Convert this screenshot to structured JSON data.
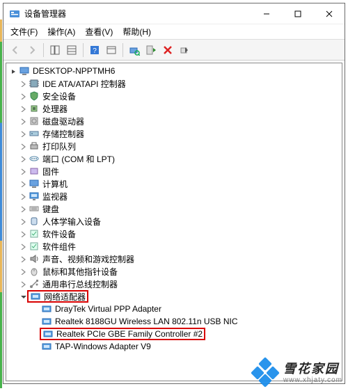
{
  "title": "设备管理器",
  "menu": {
    "file": "文件(F)",
    "action": "操作(A)",
    "view": "查看(V)",
    "help": "帮助(H)"
  },
  "tree": {
    "root": "DESKTOP-NPPTMH6",
    "categories": [
      {
        "label": "IDE ATA/ATAPI 控制器",
        "icon": "chip"
      },
      {
        "label": "安全设备",
        "icon": "shield"
      },
      {
        "label": "处理器",
        "icon": "cpu"
      },
      {
        "label": "磁盘驱动器",
        "icon": "disk"
      },
      {
        "label": "存储控制器",
        "icon": "storage"
      },
      {
        "label": "打印队列",
        "icon": "printer"
      },
      {
        "label": "端口 (COM 和 LPT)",
        "icon": "port"
      },
      {
        "label": "固件",
        "icon": "firmware"
      },
      {
        "label": "计算机",
        "icon": "computer"
      },
      {
        "label": "监视器",
        "icon": "monitor"
      },
      {
        "label": "键盘",
        "icon": "keyboard"
      },
      {
        "label": "人体学输入设备",
        "icon": "hid"
      },
      {
        "label": "软件设备",
        "icon": "software"
      },
      {
        "label": "软件组件",
        "icon": "software"
      },
      {
        "label": "声音、视频和游戏控制器",
        "icon": "sound"
      },
      {
        "label": "鼠标和其他指针设备",
        "icon": "mouse"
      },
      {
        "label": "通用串行总线控制器",
        "icon": "usb"
      }
    ],
    "networkLabel": "网络适配器",
    "adapters": [
      {
        "label": "DrayTek Virtual PPP Adapter"
      },
      {
        "label": "Realtek 8188GU Wireless LAN 802.11n USB NIC"
      },
      {
        "label": "Realtek PCIe GBE Family Controller #2",
        "highlight": true
      },
      {
        "label": "TAP-Windows Adapter V9"
      }
    ]
  },
  "watermark": {
    "line1": "雪花家园",
    "line2": "www.xhjaty.com"
  }
}
